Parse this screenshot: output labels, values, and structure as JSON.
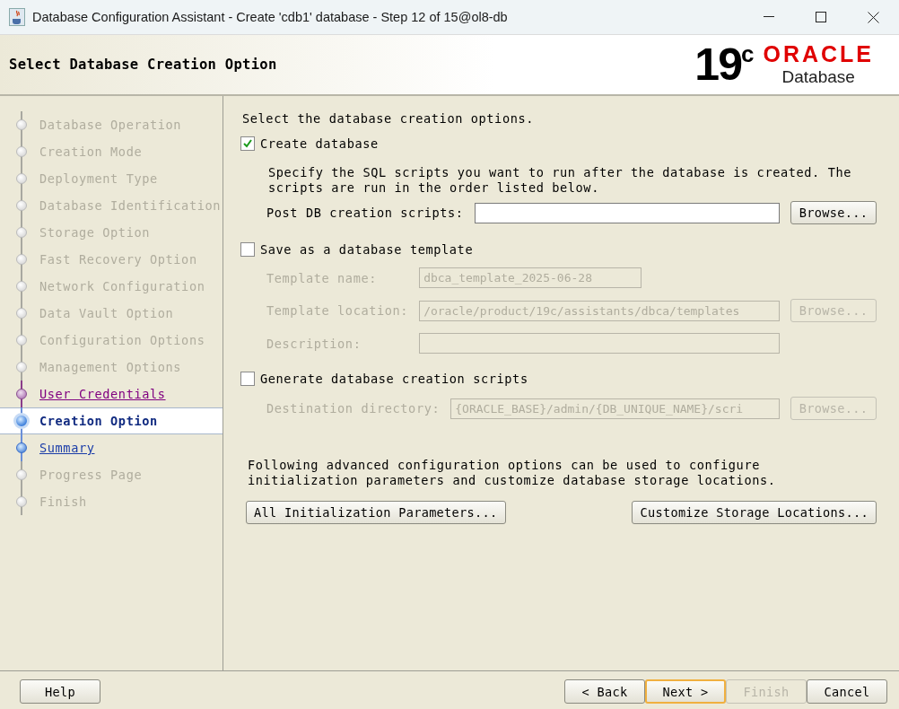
{
  "window": {
    "title": "Database Configuration Assistant - Create 'cdb1' database - Step 12 of 15@ol8-db"
  },
  "header": {
    "title": "Select Database Creation Option",
    "version": "19$^{c}$",
    "brand": "ORACLE",
    "product": "Database"
  },
  "steps": [
    {
      "label": "Database Operation",
      "kind": "done",
      "selected": false
    },
    {
      "label": "Creation Mode",
      "kind": "done",
      "selected": false
    },
    {
      "label": "Deployment Type",
      "kind": "done",
      "selected": false
    },
    {
      "label": "Database Identification",
      "kind": "done",
      "selected": false
    },
    {
      "label": "Storage Option",
      "kind": "done",
      "selected": false
    },
    {
      "label": "Fast Recovery Option",
      "kind": "done",
      "selected": false
    },
    {
      "label": "Network Configuration",
      "kind": "done",
      "selected": false
    },
    {
      "label": "Data Vault Option",
      "kind": "done",
      "selected": false
    },
    {
      "label": "Configuration Options",
      "kind": "done",
      "selected": false
    },
    {
      "label": "Management Options",
      "kind": "done",
      "selected": false
    },
    {
      "label": "User Credentials",
      "kind": "visited",
      "selected": false
    },
    {
      "label": "Creation Option",
      "kind": "current",
      "selected": true
    },
    {
      "label": "Summary",
      "kind": "link",
      "selected": false
    },
    {
      "label": "Progress Page",
      "kind": "done",
      "selected": false
    },
    {
      "label": "Finish",
      "kind": "done",
      "selected": false
    }
  ],
  "content": {
    "intro": "Select the database creation options.",
    "options": [
      {
        "label": "Create database",
        "checked": true,
        "description": "Specify the SQL scripts you want to run after the database is created. The scripts are run in the order listed below.",
        "fields": [
          {
            "label": "Post DB creation scripts:",
            "kind": "wide",
            "disabled": false,
            "button": "Browse..."
          }
        ]
      },
      {
        "label": "Save as a database template",
        "checked": false,
        "fields": [
          {
            "label": "Template name:",
            "kind": "short",
            "disabled": true,
            "value": "dbca_template_2025-06-28"
          },
          {
            "label": "Template location:",
            "kind": "wide",
            "disabled": true,
            "value": "/oracle/product/19c/assistants/dbca/templates",
            "button": "Browse..."
          },
          {
            "label": "Description:",
            "kind": "wide",
            "disabled": true
          }
        ]
      },
      {
        "label": "Generate database creation scripts",
        "checked": false,
        "fields": [
          {
            "label": "Destination directory:",
            "kind": "wide",
            "disabled": true,
            "value": "{ORACLE_BASE}/admin/{DB_UNIQUE_NAME}/scri",
            "button": "Browse..."
          }
        ]
      }
    ],
    "advanced_note": "Following advanced configuration options can be used to configure initialization parameters and customize database storage locations.",
    "advanced_buttons": [
      "All Initialization Parameters...",
      "Customize Storage Locations..."
    ]
  },
  "footer": {
    "help": "Help",
    "buttons": [
      {
        "label": "< Back",
        "disabled": false,
        "default": false
      },
      {
        "label": "Next >",
        "disabled": false,
        "default": true
      },
      {
        "label": "Finish",
        "disabled": true,
        "default": false
      },
      {
        "label": "Cancel",
        "disabled": false,
        "default": false
      }
    ]
  }
}
